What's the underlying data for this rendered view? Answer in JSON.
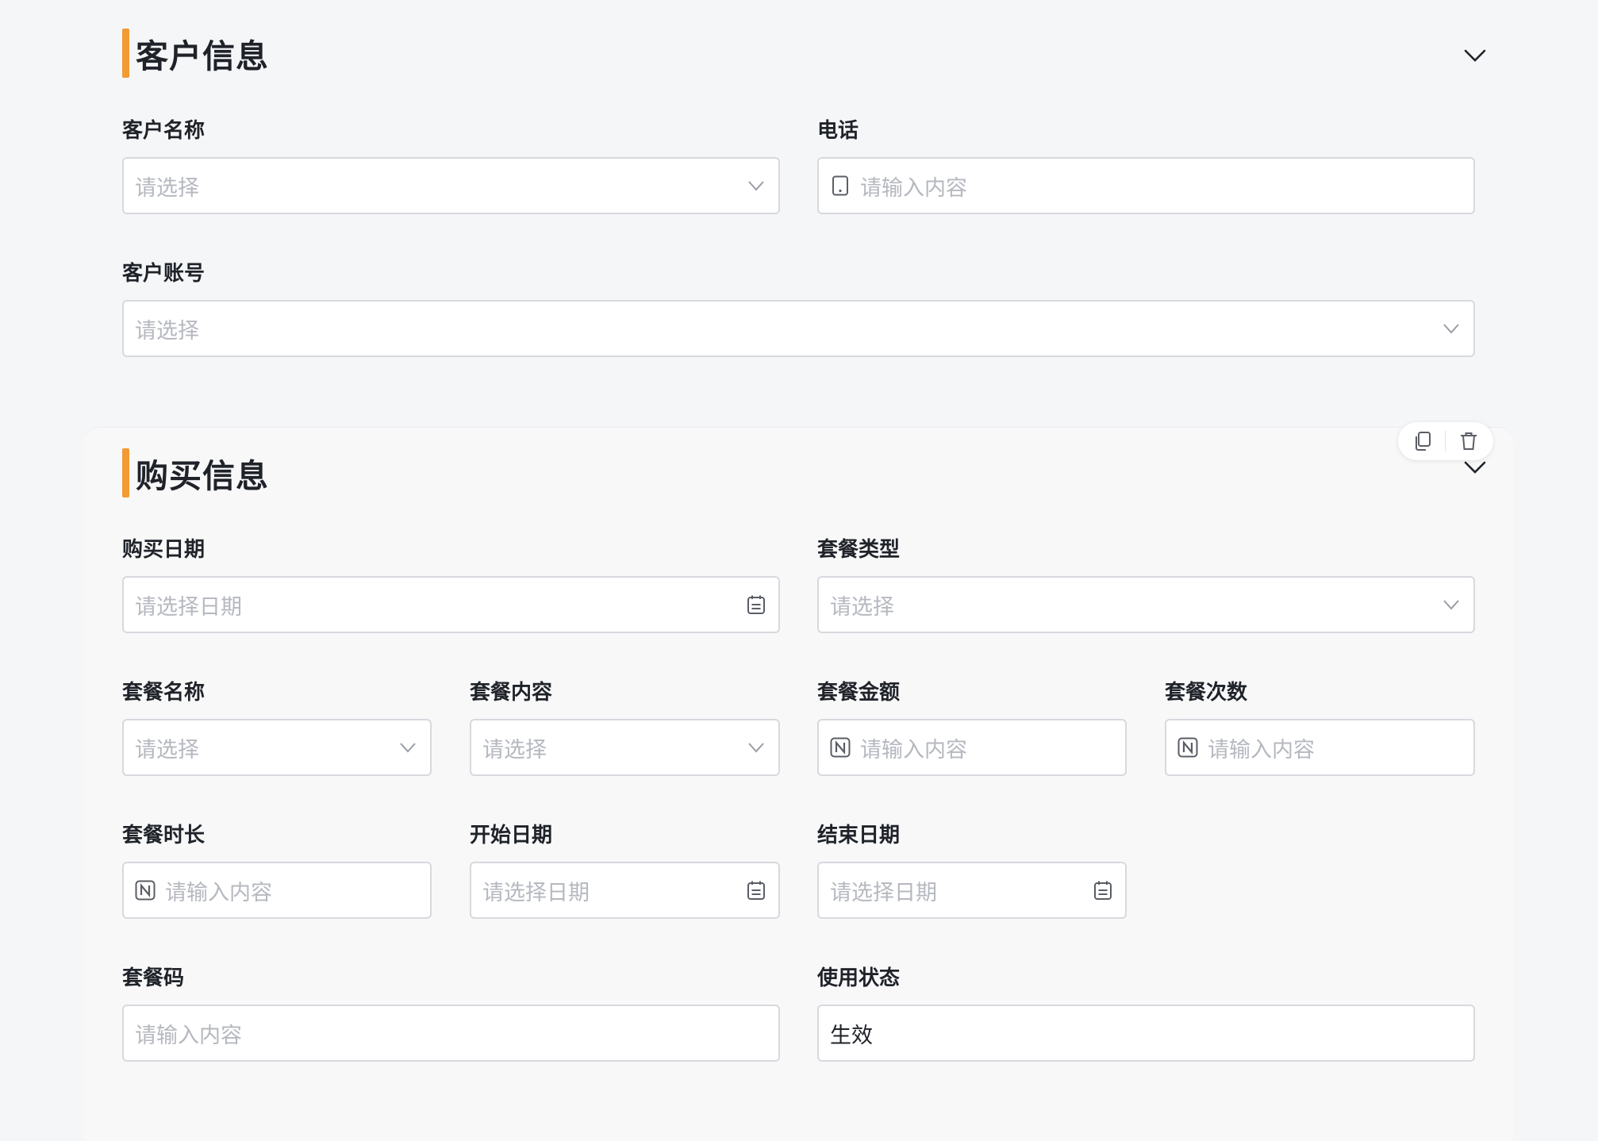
{
  "customer_section": {
    "title": "客户信息",
    "fields": {
      "customer_name": {
        "label": "客户名称",
        "placeholder": "请选择"
      },
      "phone": {
        "label": "电话",
        "placeholder": "请输入内容"
      },
      "customer_account": {
        "label": "客户账号",
        "placeholder": "请选择"
      }
    }
  },
  "purchase_section": {
    "title": "购买信息",
    "fields": {
      "purchase_date": {
        "label": "购买日期",
        "placeholder": "请选择日期"
      },
      "package_type": {
        "label": "套餐类型",
        "placeholder": "请选择"
      },
      "package_name": {
        "label": "套餐名称",
        "placeholder": "请选择"
      },
      "package_content": {
        "label": "套餐内容",
        "placeholder": "请选择"
      },
      "package_amount": {
        "label": "套餐金额",
        "placeholder": "请输入内容"
      },
      "package_count": {
        "label": "套餐次数",
        "placeholder": "请输入内容"
      },
      "package_duration": {
        "label": "套餐时长",
        "placeholder": "请输入内容"
      },
      "start_date": {
        "label": "开始日期",
        "placeholder": "请选择日期"
      },
      "end_date": {
        "label": "结束日期",
        "placeholder": "请选择日期"
      },
      "package_code": {
        "label": "套餐码",
        "placeholder": "请输入内容"
      },
      "usage_status": {
        "label": "使用状态",
        "value": "生效"
      }
    }
  },
  "icons": {
    "collapse": "chevron-down-icon",
    "select": "chevron-down-icon",
    "phone": "phone-icon",
    "number": "number-icon",
    "date": "calendar-icon",
    "copy": "copy-icon",
    "delete": "trash-icon"
  },
  "colors": {
    "accent": "#f29a33",
    "border": "#d7d9de",
    "placeholder": "#b5b8bf",
    "text": "#1f2329"
  }
}
